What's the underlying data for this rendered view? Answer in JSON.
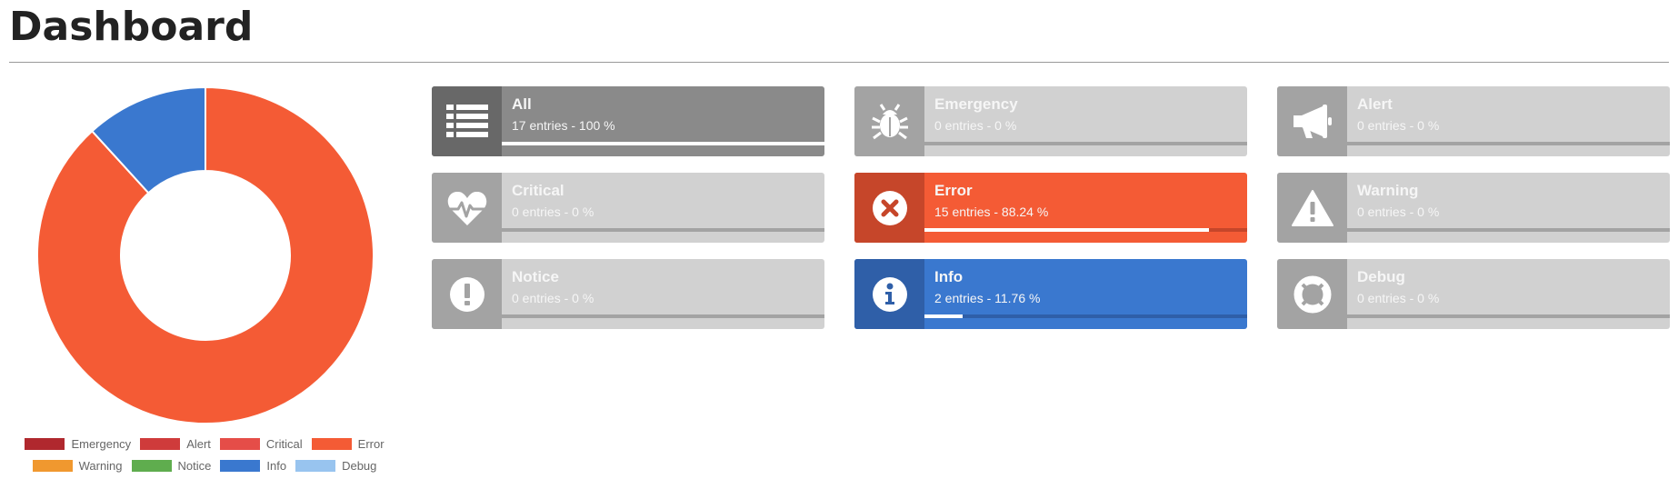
{
  "page": {
    "title": "Dashboard"
  },
  "chart_data": {
    "type": "pie",
    "categories": [
      "Emergency",
      "Alert",
      "Critical",
      "Error",
      "Warning",
      "Notice",
      "Info",
      "Debug"
    ],
    "values": [
      0,
      0,
      0,
      15,
      0,
      0,
      2,
      0
    ],
    "colors": [
      "#b0282e",
      "#cf3b3b",
      "#e54d48",
      "#f45b35",
      "#f0982f",
      "#5fad4e",
      "#3a78cf",
      "#98c4ef"
    ],
    "donut": true
  },
  "legend": {
    "rows": [
      [
        {
          "label": "Emergency",
          "color": "#b0282e"
        },
        {
          "label": "Alert",
          "color": "#cf3b3b"
        },
        {
          "label": "Critical",
          "color": "#e54d48"
        },
        {
          "label": "Error",
          "color": "#f45b35"
        }
      ],
      [
        {
          "label": "Warning",
          "color": "#f0982f"
        },
        {
          "label": "Notice",
          "color": "#5fad4e"
        },
        {
          "label": "Info",
          "color": "#3a78cf"
        },
        {
          "label": "Debug",
          "color": "#98c4ef"
        }
      ]
    ]
  },
  "tiles": [
    {
      "id": "all",
      "label": "All",
      "count": "17 entries - 100 %",
      "percent": 100,
      "icon": "list-icon"
    },
    {
      "id": "emergency",
      "label": "Emergency",
      "count": "0 entries - 0 %",
      "percent": 0,
      "icon": "bug-icon"
    },
    {
      "id": "alert",
      "label": "Alert",
      "count": "0 entries - 0 %",
      "percent": 0,
      "icon": "megaphone-icon"
    },
    {
      "id": "critical",
      "label": "Critical",
      "count": "0 entries - 0 %",
      "percent": 0,
      "icon": "heartbeat-icon"
    },
    {
      "id": "error",
      "label": "Error",
      "count": "15 entries - 88.24 %",
      "percent": 88.24,
      "icon": "times-circle-icon"
    },
    {
      "id": "warning",
      "label": "Warning",
      "count": "0 entries - 0 %",
      "percent": 0,
      "icon": "warning-triangle-icon"
    },
    {
      "id": "notice",
      "label": "Notice",
      "count": "0 entries - 0 %",
      "percent": 0,
      "icon": "exclamation-circle-icon"
    },
    {
      "id": "info",
      "label": "Info",
      "count": "2 entries - 11.76 %",
      "percent": 11.76,
      "icon": "info-circle-icon"
    },
    {
      "id": "debug",
      "label": "Debug",
      "count": "0 entries - 0 %",
      "percent": 0,
      "icon": "life-ring-icon"
    }
  ]
}
